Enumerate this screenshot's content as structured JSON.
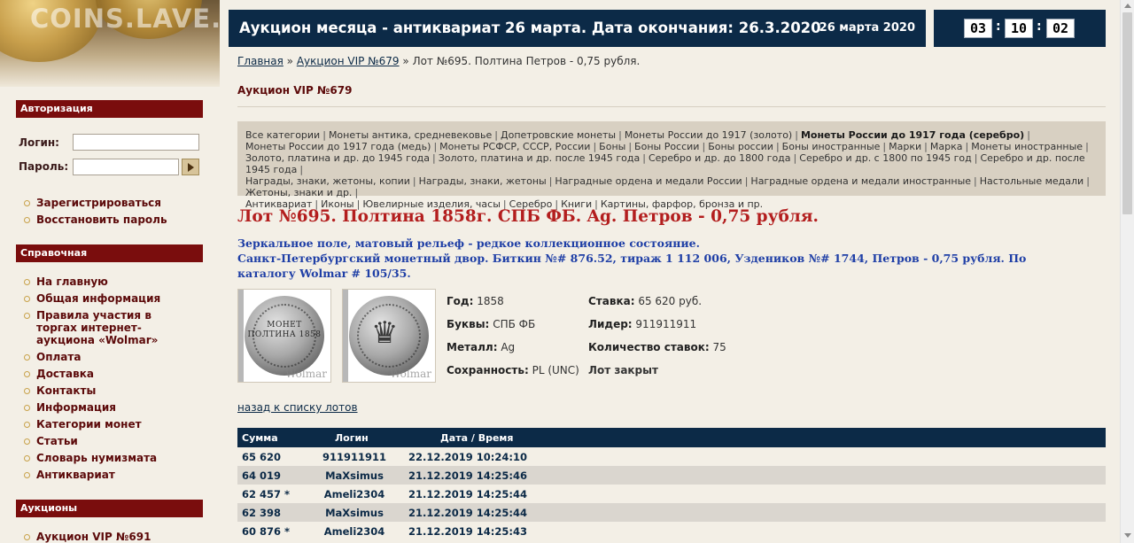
{
  "site": {
    "logo_text": "COINS.LAVE.RU"
  },
  "header": {
    "title": "Аукцион месяца - антиквариат 26 марта. Дата окончания: 26.3.2020",
    "date": "26 марта 2020",
    "timer": {
      "hours": "03",
      "minutes": "10",
      "seconds": "02",
      "separator": ":"
    }
  },
  "sidebar": {
    "auth": {
      "heading": "Авторизация",
      "login_label": "Логин:",
      "password_label": "Пароль:",
      "login_value": "",
      "password_value": "",
      "submit_icon": "arrow-right-icon",
      "links": [
        "Зарегистрироваться",
        "Восстановить пароль"
      ]
    },
    "reference": {
      "heading": "Справочная",
      "items": [
        "На главную",
        "Общая информация",
        "Правила участия в торгах интернет-аукциона «Wolmar»",
        "Оплата",
        "Доставка",
        "Контакты",
        "Информация",
        "Категории монет",
        "Статьи",
        "Словарь нумизмата",
        "Антиквариат"
      ]
    },
    "auctions": {
      "heading": "Аукционы",
      "items": [
        "Аукцион VIP №691"
      ]
    }
  },
  "breadcrumb": {
    "home": "Главная",
    "sep": "»",
    "auction": "Аукцион VIP №679",
    "current": "Лот №695. Полтина Петров - 0,75 рубля."
  },
  "auction_name": "Аукцион VIP №679",
  "categories": {
    "separator": "|",
    "rows": [
      [
        {
          "label": "Все категории"
        },
        {
          "label": "Монеты антика, средневековье"
        },
        {
          "label": "Допетровские монеты"
        },
        {
          "label": "Монеты России до 1917 (золото)"
        },
        {
          "label": "Монеты России до 1917 года (серебро)",
          "active": true
        }
      ],
      [
        {
          "label": "Монеты России до 1917 года (медь)"
        },
        {
          "label": "Монеты РСФСР, СССР, России"
        },
        {
          "label": "Боны"
        },
        {
          "label": "Боны России"
        },
        {
          "label": "Боны россии"
        },
        {
          "label": "Боны иностранные"
        },
        {
          "label": "Марки"
        },
        {
          "label": "Марка"
        },
        {
          "label": "Монеты иностранные"
        }
      ],
      [
        {
          "label": "Золото, платина и др. до 1945 года"
        },
        {
          "label": "Золото, платина и др. после 1945 года"
        },
        {
          "label": "Серебро и др. до 1800 года"
        },
        {
          "label": "Серебро и др. с 1800 по 1945 год"
        },
        {
          "label": "Серебро и др. после 1945 года"
        }
      ],
      [
        {
          "label": "Награды, знаки, жетоны, копии"
        },
        {
          "label": "Награды, знаки, жетоны"
        },
        {
          "label": "Наградные ордена и медали России"
        },
        {
          "label": "Наградные ордена и медали иностранные"
        },
        {
          "label": "Настольные медали"
        },
        {
          "label": "Жетоны, знаки и др."
        }
      ],
      [
        {
          "label": "Антиквариат"
        },
        {
          "label": "Иконы"
        },
        {
          "label": "Ювелирные изделия, часы"
        },
        {
          "label": "Серебро"
        },
        {
          "label": "Книги"
        },
        {
          "label": "Картины, фарфор, бронза и пр."
        }
      ]
    ]
  },
  "lot": {
    "title": "Лот №695.  Полтина 1858г. СПБ ФБ. Ag. Петров - 0,75 рубля.",
    "desc_line1": "Зеркальное поле, матовый рельеф - редкое коллекционное состояние.",
    "desc_line2": "Санкт-Петербургский монетный двор. Биткин №# 876.52, тираж 1 112 006, Уздеников №# 1744, Петров - 0,75 рубля. По каталогу Wolmar # 105/35.",
    "images": {
      "watermark": "Wolmar",
      "reverse_text": "МОНЕТ ПОЛТИНА 1858",
      "obverse_icon": "double-eagle-icon"
    },
    "specs": {
      "year_label": "Год:",
      "year": "1858",
      "letters_label": "Буквы:",
      "letters": "СПБ ФБ",
      "metal_label": "Металл:",
      "metal": "Ag",
      "grade_label": "Сохранность:",
      "grade": "PL (UNC)",
      "bid_label": "Ставка:",
      "bid": "65 620 руб.",
      "leader_label": "Лидер:",
      "leader": "911911911",
      "count_label": "Количество ставок:",
      "count": "75",
      "status": "Лот закрыт"
    },
    "back_link": "назад к списку лотов"
  },
  "bids": {
    "headers": {
      "sum": "Сумма",
      "login": "Логин",
      "datetime": "Дата / Время"
    },
    "rows": [
      {
        "sum": "65 620",
        "star": "",
        "login": "911911911",
        "datetime": "22.12.2019 10:24:10"
      },
      {
        "sum": "64 019",
        "star": "",
        "login": "MaXsimus",
        "datetime": "21.12.2019 14:25:46"
      },
      {
        "sum": "62 457",
        "star": "*",
        "login": "Ameli2304",
        "datetime": "21.12.2019 14:25:44"
      },
      {
        "sum": "62 398",
        "star": "",
        "login": "MaXsimus",
        "datetime": "21.12.2019 14:25:44"
      },
      {
        "sum": "60 876",
        "star": "*",
        "login": "Ameli2304",
        "datetime": "21.12.2019 14:25:43"
      }
    ]
  },
  "colors": {
    "navy": "#0c2a47",
    "maroon": "#7a0d0d",
    "lot_title_red": "#b31e1e",
    "desc_blue": "#1f3fa6",
    "page_bg": "#f3efe6"
  }
}
